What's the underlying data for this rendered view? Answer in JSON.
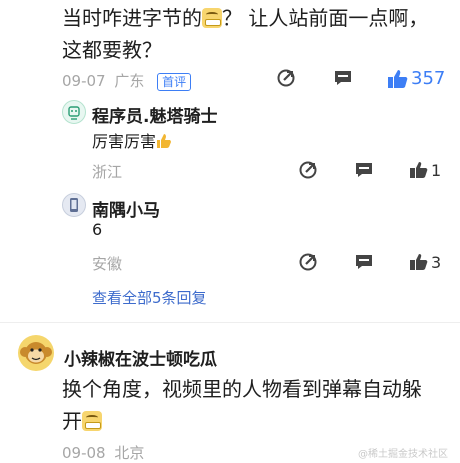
{
  "top_comment": {
    "text_line1_before": "当时咋进字节的",
    "text_line1_after": "？ 让人站前面一点啊，",
    "text_line2": "这都要教？",
    "date": "09-07",
    "location": "广东",
    "tag": "首评",
    "like_count": "357"
  },
  "replies": [
    {
      "name": "程序员.魅塔骑士",
      "text": "厉害厉害",
      "location": "浙江",
      "like_count": "1"
    },
    {
      "name": "南隅小马",
      "text": "6",
      "location": "安徽",
      "like_count": "3"
    }
  ],
  "view_all": "查看全部5条回复",
  "second_comment": {
    "name": "小辣椒在波士顿吃瓜",
    "text_line1": "换个角度，视频里的人物看到弹幕自动躲",
    "text_line2": "开",
    "date": "09-08",
    "location": "北京"
  },
  "watermark": "@稀土掘金技术社区",
  "colors": {
    "accent": "#3d7ef5",
    "meta": "#a6a6a6",
    "link": "#3d6bcc"
  }
}
